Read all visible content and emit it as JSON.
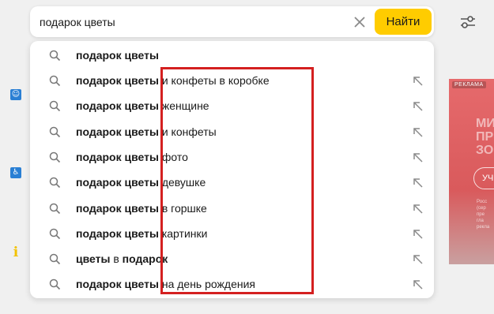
{
  "search": {
    "query": "подарок цветы",
    "clear_icon": "close-icon",
    "button_label": "Найти",
    "button_color": "#ffcc00"
  },
  "toolbar": {
    "filter_icon": "sliders-icon"
  },
  "suggestions": [
    {
      "bold": "подарок цветы",
      "rest": ""
    },
    {
      "bold": "подарок цветы",
      "rest": " и конфеты в коробке"
    },
    {
      "bold": "подарок цветы",
      "rest": " женщине"
    },
    {
      "bold": "подарок цветы",
      "rest": " и конфеты"
    },
    {
      "bold": "подарок цветы",
      "rest": " фото"
    },
    {
      "bold": "подарок цветы",
      "rest": " девушке"
    },
    {
      "bold": "подарок цветы",
      "rest": " в горшке"
    },
    {
      "bold": "подарок цветы",
      "rest": " картинки"
    },
    {
      "bold": "цветы",
      "rest": " в ",
      "bold2": "подарок"
    },
    {
      "bold": "подарок цветы",
      "rest": " на день рождения"
    }
  ],
  "ad": {
    "badge": "РЕКЛАМА",
    "headline": "МИ\nПР\nЗО",
    "button": "УЧ",
    "fine_print": "Росс\n(сер\nпре\nгла\nрекла"
  },
  "annotation": {
    "color": "#d42020"
  }
}
